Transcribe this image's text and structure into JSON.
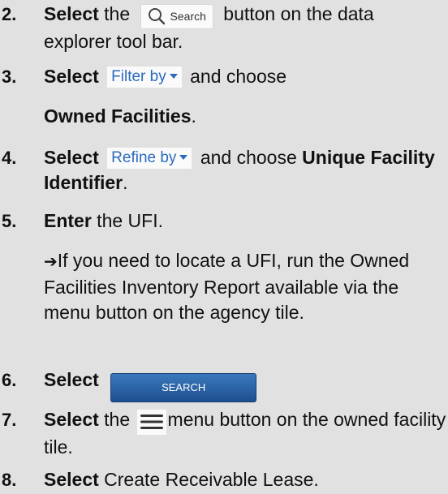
{
  "steps": [
    {
      "num": "2.",
      "verb": "Select",
      "pre": " the",
      "search_button_label": "Search",
      "post": " button on the data explorer tool bar."
    },
    {
      "num": "3.",
      "verb": "Select",
      "filter_label": "Filter by",
      "mid": "and choose",
      "choice": "Owned Facilities",
      "end": "."
    },
    {
      "num": "4.",
      "verb": "Select",
      "refine_label": "Refine by",
      "mid": "and choose",
      "choice": "Unique Facility Identifier",
      "end": "."
    },
    {
      "num": "5.",
      "verb": "Enter",
      "rest": " the UFI.",
      "note": "If you need to locate a UFI, run the Owned Facilities Inventory Report available via the menu button on the agency tile."
    },
    {
      "num": "6.",
      "verb": "Select",
      "search_action_label": "SEARCH"
    },
    {
      "num": "7.",
      "verb": "Select",
      "pre": " the",
      "post": "menu button on the owned facility tile."
    },
    {
      "num": "8.",
      "verb": "Select",
      "rest": " Create Receivable Lease."
    }
  ],
  "icons": {
    "search": "magnifier-icon",
    "menu": "hamburger-menu-icon",
    "arrow": "right-arrow-icon"
  },
  "colors": {
    "background": "#e1e1e1",
    "link": "#2b6bbf",
    "button_blue": "#2a64a8"
  }
}
